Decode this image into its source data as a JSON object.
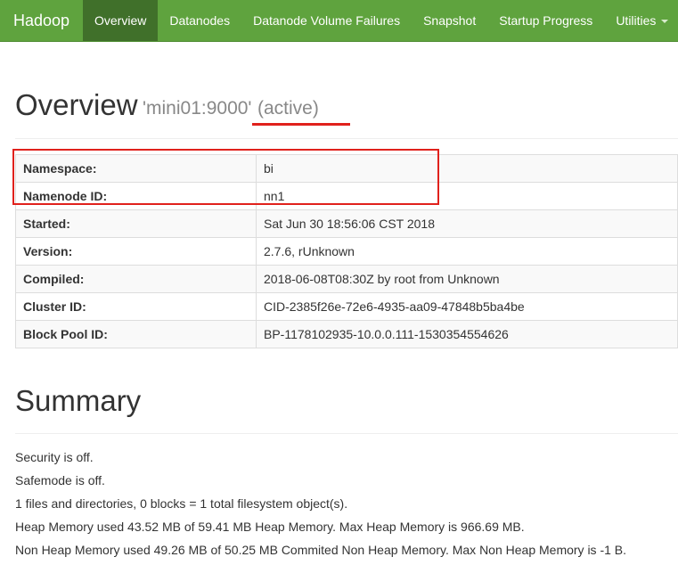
{
  "navbar": {
    "brand": "Hadoop",
    "items": [
      {
        "label": "Overview",
        "active": true
      },
      {
        "label": "Datanodes",
        "active": false
      },
      {
        "label": "Datanode Volume Failures",
        "active": false
      },
      {
        "label": "Snapshot",
        "active": false
      },
      {
        "label": "Startup Progress",
        "active": false
      },
      {
        "label": "Utilities",
        "active": false,
        "has_dropdown": true
      }
    ]
  },
  "overview": {
    "title": "Overview",
    "host": "'mini01:9000'",
    "state": "(active)",
    "rows": [
      {
        "label": "Namespace:",
        "value": "bi"
      },
      {
        "label": "Namenode ID:",
        "value": "nn1"
      },
      {
        "label": "Started:",
        "value": "Sat Jun 30 18:56:06 CST 2018"
      },
      {
        "label": "Version:",
        "value": "2.7.6, rUnknown"
      },
      {
        "label": "Compiled:",
        "value": "2018-06-08T08:30Z by root from Unknown"
      },
      {
        "label": "Cluster ID:",
        "value": "CID-2385f26e-72e6-4935-aa09-47848b5ba4be"
      },
      {
        "label": "Block Pool ID:",
        "value": "BP-1178102935-10.0.0.111-1530354554626"
      }
    ]
  },
  "summary": {
    "title": "Summary",
    "lines": [
      "Security is off.",
      "Safemode is off.",
      "1 files and directories, 0 blocks = 1 total filesystem object(s).",
      "Heap Memory used 43.52 MB of 59.41 MB Heap Memory. Max Heap Memory is 966.69 MB.",
      "Non Heap Memory used 49.26 MB of 50.25 MB Commited Non Heap Memory. Max Non Heap Memory is -1 B."
    ]
  },
  "colors": {
    "navbar": "#5fa33e",
    "navbar_active": "#40702a",
    "highlight_red": "#e0211c"
  }
}
